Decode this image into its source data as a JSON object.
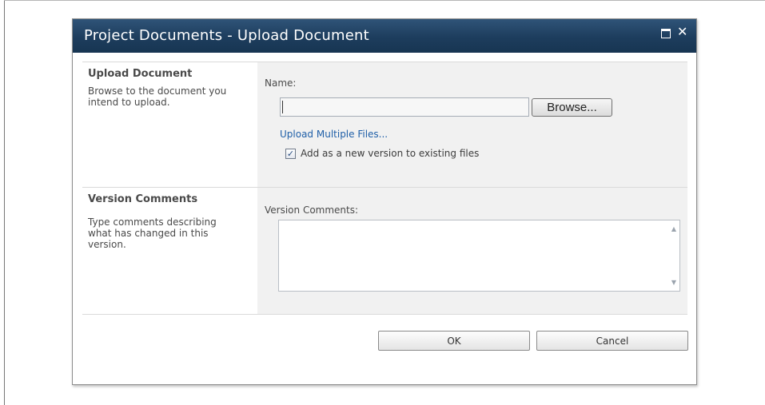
{
  "dialog": {
    "title": "Project Documents - Upload Document",
    "maximize_icon": "maximize-icon",
    "close_icon": "close-icon",
    "close_glyph": "✕"
  },
  "upload_section": {
    "title": "Upload Document",
    "description": "Browse to the document you intend to upload.",
    "name_label": "Name:",
    "name_value": "",
    "browse_label": "Browse...",
    "upload_multiple_label": "Upload Multiple Files...",
    "add_version_checked": true,
    "add_version_label": "Add as a new version to existing files"
  },
  "comments_section": {
    "title": "Version Comments",
    "description": "Type comments describing what has changed in this version.",
    "comments_label": "Version Comments:",
    "comments_value": ""
  },
  "footer": {
    "ok_label": "OK",
    "cancel_label": "Cancel"
  },
  "colors": {
    "titlebar": "#1d3d5d",
    "link": "#1f5fa8",
    "field_background": "#f1f1f1"
  }
}
